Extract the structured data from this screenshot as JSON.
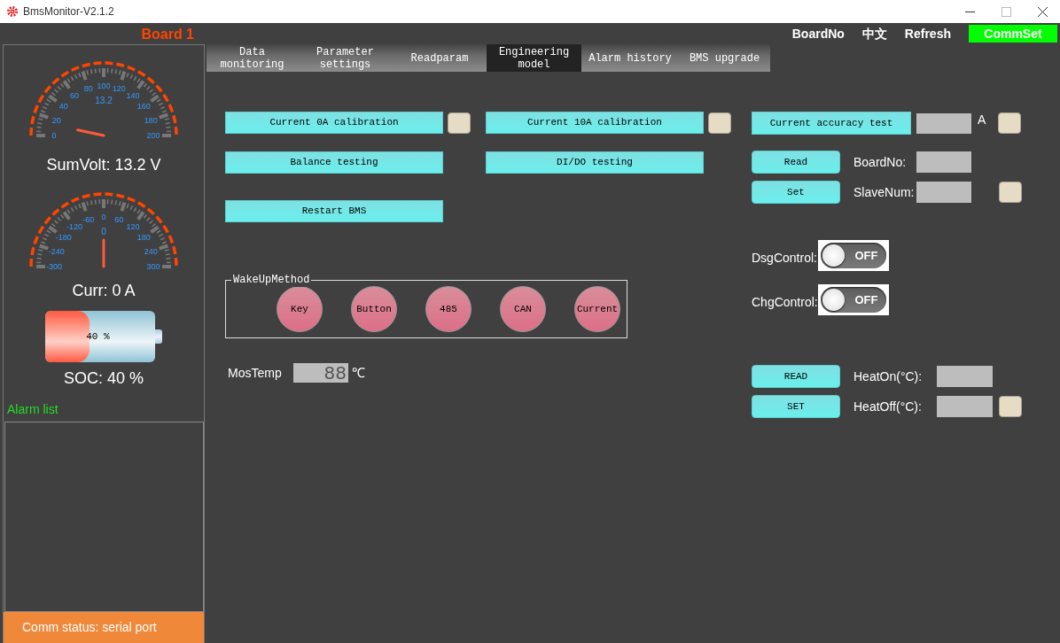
{
  "window": {
    "title": "BmsMonitor-V2.1.2"
  },
  "board_label": "Board 1",
  "header_buttons": [
    {
      "label": "BoardNo",
      "highlighted": false
    },
    {
      "label": "中文",
      "highlighted": false
    },
    {
      "label": "Refresh",
      "highlighted": false
    },
    {
      "label": "CommSet",
      "highlighted": true
    }
  ],
  "gauges": [
    {
      "ticks": [
        "0",
        "20",
        "40",
        "60",
        "80",
        "100",
        "120",
        "140",
        "160",
        "180",
        "200"
      ],
      "reading": "13.2",
      "caption": "SumVolt: 13.2 V"
    },
    {
      "ticks": [
        "-300",
        "-240",
        "-180",
        "-120",
        "-60",
        "0",
        "60",
        "120",
        "180",
        "240",
        "300"
      ],
      "reading": "0",
      "caption": "Curr: 0 A"
    }
  ],
  "battery": {
    "level": 0.4,
    "text": "40 %",
    "caption": "SOC: 40 %"
  },
  "alarm_list": {
    "title": "Alarm list"
  },
  "status_bar": "Comm status: serial port",
  "tabs": [
    {
      "label": "Data monitoring",
      "selected": false
    },
    {
      "label": "Parameter settings",
      "selected": false
    },
    {
      "label": "Readparam",
      "selected": false
    },
    {
      "label": "Engineering model",
      "selected": true
    },
    {
      "label": "Alarm history",
      "selected": false
    },
    {
      "label": "BMS upgrade",
      "selected": false
    }
  ],
  "actions": [
    {
      "label": "Current 0A calibration",
      "indicator": true
    },
    {
      "label": "Current 10A calibration",
      "indicator": true
    },
    {
      "label": "Balance testing",
      "indicator": false
    },
    {
      "label": "DI/DO testing",
      "indicator": false
    },
    {
      "label": "Restart BMS",
      "indicator": false
    }
  ],
  "wakeup_method": {
    "title": "WakeUpMethod",
    "options": [
      "Key",
      "Button",
      "485",
      "CAN",
      "Current"
    ]
  },
  "mos_temp": {
    "label": "MosTemp",
    "value": "88",
    "unit": "℃"
  },
  "accuracy_test": {
    "label": "Current accuracy test",
    "unit": "A",
    "indicator": true
  },
  "board_settings": {
    "buttons": [
      "Read",
      "Set"
    ],
    "fields": [
      {
        "label": "BoardNo:",
        "indicator": false
      },
      {
        "label": "SlaveNum:",
        "indicator": true
      }
    ]
  },
  "switches": [
    {
      "label": "DsgControl:",
      "on": false,
      "text": "OFF"
    },
    {
      "label": "ChgControl:",
      "on": false,
      "text": "OFF"
    }
  ],
  "heating": {
    "buttons": [
      "READ",
      "SET"
    ],
    "fields": [
      {
        "label": "HeatOn(°C):",
        "indicator": false
      },
      {
        "label": "HeatOff(°C):",
        "indicator": true
      }
    ]
  }
}
